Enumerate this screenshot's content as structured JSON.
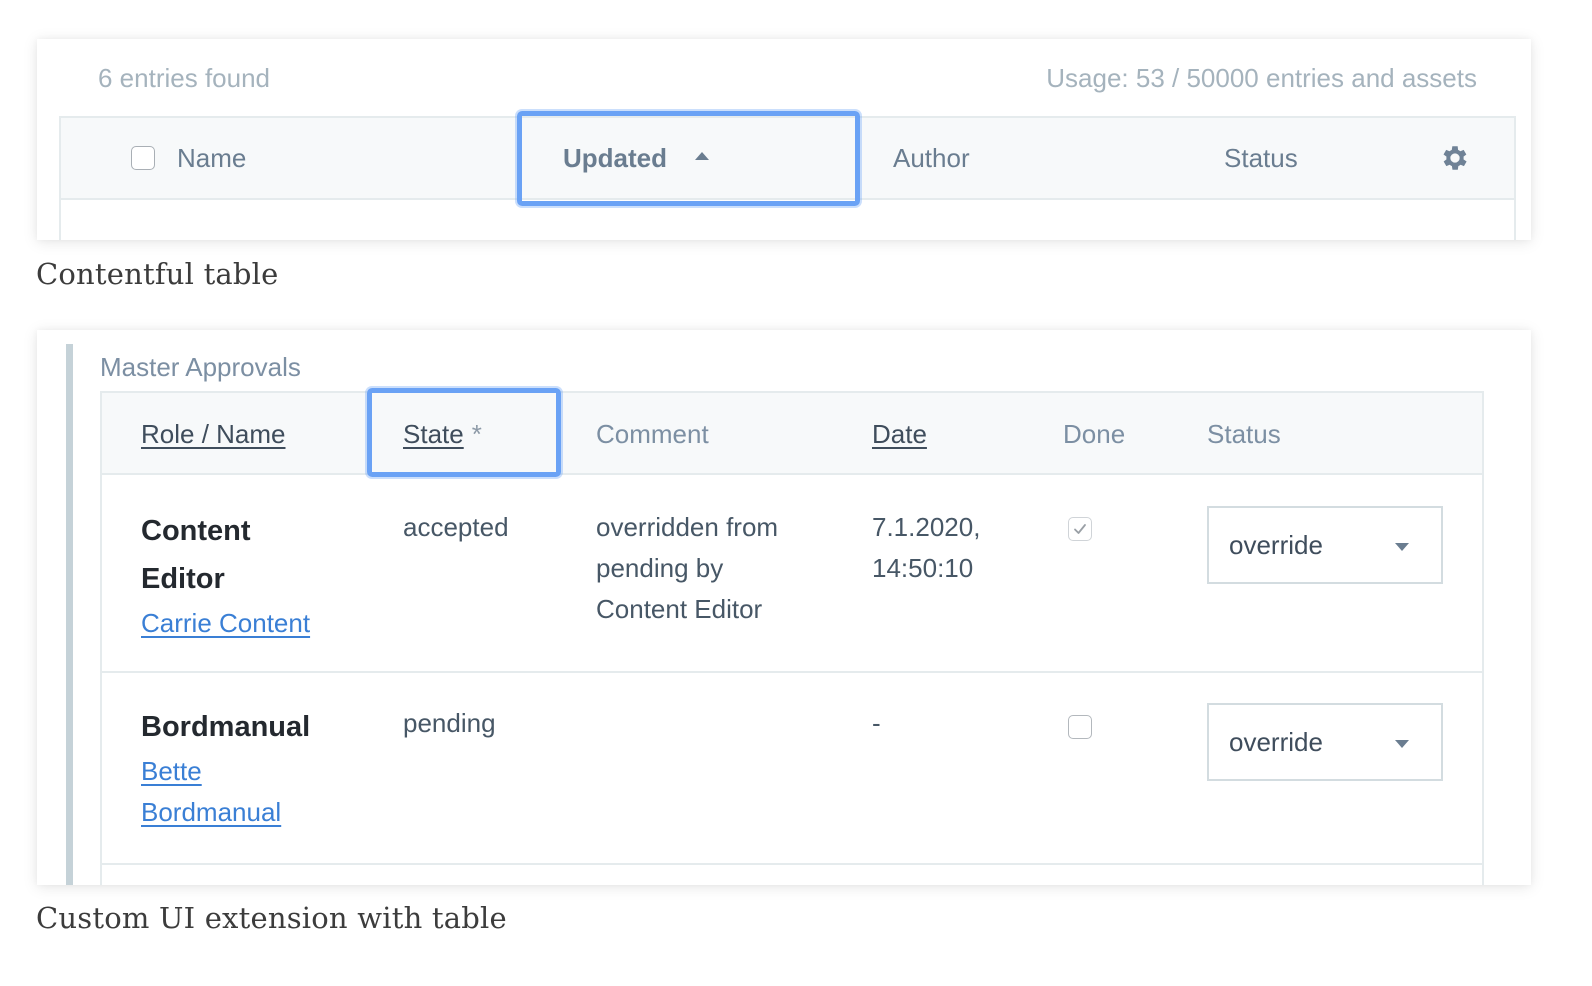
{
  "contentful_table": {
    "entries_found": "6 entries found",
    "usage": "Usage: 53 / 50000 entries and assets",
    "columns": [
      {
        "label": "Name",
        "sorted": false
      },
      {
        "label": "Updated",
        "sorted": true,
        "sort_direction": "ascending"
      },
      {
        "label": "Author",
        "sorted": false
      },
      {
        "label": "Status",
        "sorted": false
      }
    ],
    "select_all_checked": false,
    "settings_icon": "gear-icon",
    "caption": "Contentful table"
  },
  "custom_extension": {
    "section_title": "Master Approvals",
    "columns": [
      {
        "label": "Role / Name",
        "sortable": true
      },
      {
        "label": "State",
        "sortable": true,
        "marker": "*"
      },
      {
        "label": "Comment",
        "sortable": false
      },
      {
        "label": "Date",
        "sortable": true
      },
      {
        "label": "Done",
        "sortable": false
      },
      {
        "label": "Status",
        "sortable": false
      }
    ],
    "rows": [
      {
        "role": "Content Editor",
        "role_line1": "Content",
        "role_line2": "Editor",
        "user": "Carrie Content",
        "state": "accepted",
        "comment_lines": [
          "overridden from",
          "pending by",
          "Content Editor"
        ],
        "date_lines": [
          "7.1.2020,",
          "14:50:10"
        ],
        "done": true,
        "status": "override"
      },
      {
        "role": "Bordmanual",
        "user": "Bette Bordmanual",
        "user_line1": "Bette",
        "user_line2": "Bordmanual",
        "state": "pending",
        "comment_lines": [],
        "date_lines": [
          "-"
        ],
        "done": false,
        "status": "override"
      }
    ],
    "caption": "Custom UI extension with table"
  },
  "colors": {
    "focus_ring": "#6aa2f5",
    "link": "#3a7fd5",
    "header_bg": "#f7f9fa",
    "muted_text": "#a5b3bd"
  }
}
